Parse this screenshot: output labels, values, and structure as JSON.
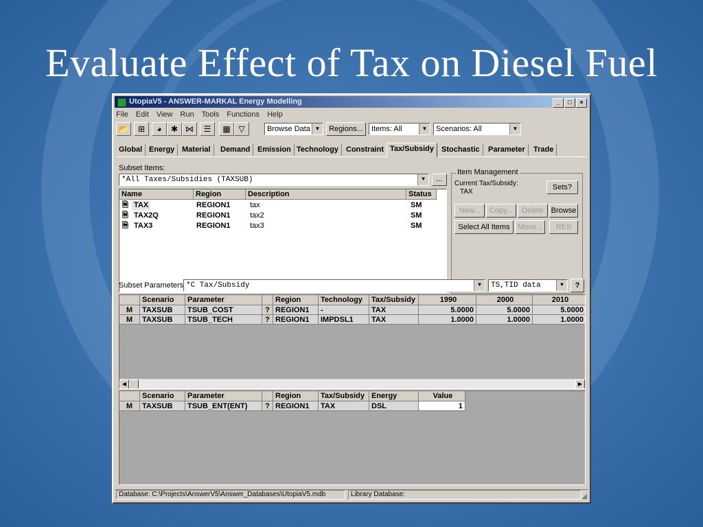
{
  "slide": {
    "title": "Evaluate Effect of Tax on Diesel Fuel"
  },
  "window": {
    "title": "UtopiaV5 - ANSWER-MARKAL Energy Modelling",
    "min": "_",
    "max": "□",
    "close": "×"
  },
  "menu": [
    "File",
    "Edit",
    "View",
    "Run",
    "Tools",
    "Functions",
    "Help"
  ],
  "toolbar": {
    "browse_combo": "Browse Data",
    "regions_button": "Regions...",
    "items_combo": "Items: All",
    "scenarios_combo": "Scenarios: All"
  },
  "tabs": [
    "Global",
    "Energy",
    "Material",
    "Demand",
    "Emission",
    "Technology",
    "Constraint",
    "Tax/Subsidy",
    "Stochastic",
    "Parameter",
    "Trade"
  ],
  "active_tab": "Tax/Subsidy",
  "subset_items": {
    "label": "Subset Items:",
    "value": "*All Taxes/Subsidies (TAXSUB)",
    "more_button": "..."
  },
  "items_table": {
    "headers": [
      "Name",
      "Region",
      "Description",
      "Status"
    ],
    "rows": [
      {
        "name": "TAX",
        "region": "REGION1",
        "description": "tax",
        "status": "SM"
      },
      {
        "name": "TAX2Q",
        "region": "REGION1",
        "description": "tax2",
        "status": "SM"
      },
      {
        "name": "TAX3",
        "region": "REGION1",
        "description": "tax3",
        "status": "SM"
      }
    ]
  },
  "item_management": {
    "title": "Item Management",
    "current_label": "Current Tax/Subsidy:",
    "current_value": "TAX",
    "sets_button": "Sets?",
    "new_button": "New...",
    "copy_button": "Copy...",
    "delete_button": "Delete",
    "browse_button": "Browse",
    "select_all_button": "Select All Items",
    "move_button": "Move...",
    "res_button": "RES"
  },
  "subset_params": {
    "label": "Subset Parameters:",
    "value": "*C  Tax/Subsidy",
    "ts_value": "TS,TID data",
    "help_button": "?"
  },
  "param_grid": {
    "headers": [
      "",
      "Scenario",
      "Parameter",
      "",
      "Region",
      "Technology",
      "Tax/Subsidy",
      "1990",
      "2000",
      "2010"
    ],
    "rows": [
      [
        "M",
        "TAXSUB",
        "TSUB_COST",
        "?",
        "REGION1",
        "-",
        "TAX",
        "5.0000",
        "5.0000",
        "5.0000"
      ],
      [
        "M",
        "TAXSUB",
        "TSUB_TECH",
        "?",
        "REGION1",
        "IMPDSL1",
        "TAX",
        "1.0000",
        "1.0000",
        "1.0000"
      ]
    ]
  },
  "lower_grid": {
    "headers": [
      "",
      "Scenario",
      "Parameter",
      "",
      "Region",
      "Tax/Subsidy",
      "Energy",
      "Value"
    ],
    "rows": [
      [
        "M",
        "TAXSUB",
        "TSUB_ENT(ENT)",
        "?",
        "REGION1",
        "TAX",
        "DSL",
        "1"
      ]
    ]
  },
  "scroll": {
    "left": "◀",
    "right": "▶"
  },
  "status": {
    "database": "Database: C:\\Projects\\AnswerV5\\Answer_Databases\\UtopiaV5.mdb",
    "library": "Library Database:"
  }
}
